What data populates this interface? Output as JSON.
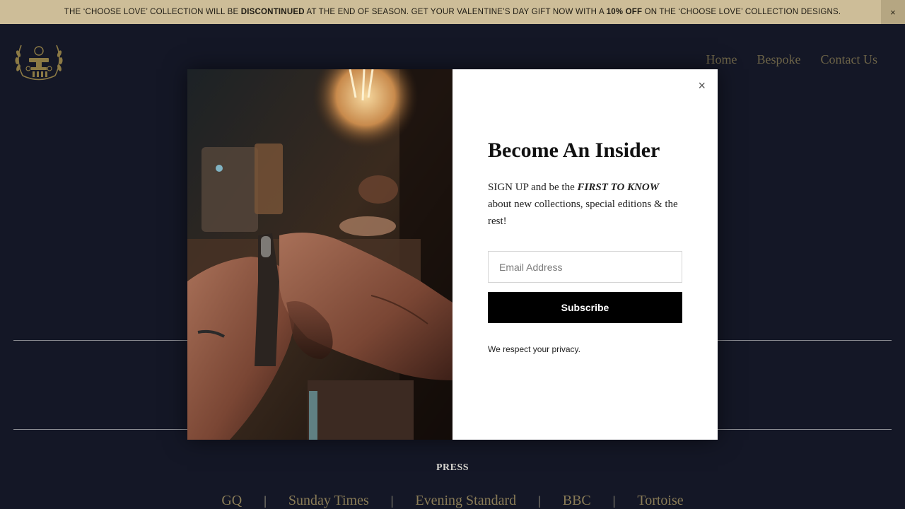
{
  "announcement": {
    "part1": "THE ‘CHOOSE LOVE’ COLLECTION WILL BE ",
    "bold1": "DISCONTINUED",
    "part2": " AT THE END OF SEASON. GET YOUR VALENTINE’S DAY GIFT NOW WITH A ",
    "bold2": "10% OFF",
    "part3": " ON THE ‘CHOOSE LOVE’ COLLECTION DESIGNS.",
    "close": "×"
  },
  "nav": {
    "home": "Home",
    "bespoke": "Bespoke",
    "contact": "Contact Us"
  },
  "press": {
    "title": "PRESS",
    "separator": "|",
    "items": [
      "GQ",
      "Sunday Times",
      "Evening Standard",
      "BBC",
      "Tortoise"
    ]
  },
  "popup": {
    "close": "×",
    "title": "Become An Insider",
    "text_before": "SIGN UP and be the ",
    "text_emphasis": "FIRST TO KNOW",
    "text_after": " about new collections, special editions & the rest!",
    "email_placeholder": "Email Address",
    "subscribe_label": "Subscribe",
    "privacy": "We respect your privacy."
  },
  "colors": {
    "background": "#141726",
    "announcement_bg": "#cdbd98",
    "nav_link": "#6d6448",
    "press_link": "#8a7c57",
    "button_bg": "#000000"
  }
}
